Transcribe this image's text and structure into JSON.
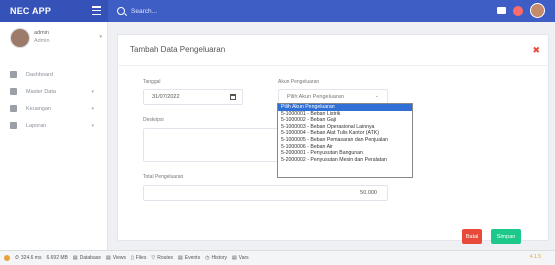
{
  "app": {
    "brand": "NEC APP"
  },
  "header": {
    "search_placeholder": "Search..."
  },
  "user": {
    "name": "admin",
    "role": "Admin"
  },
  "sidebar": {
    "items": [
      {
        "label": "Dashboard",
        "icon": "home-icon"
      },
      {
        "label": "Master Data",
        "icon": "database-icon"
      },
      {
        "label": "Keuangan",
        "icon": "money-icon"
      },
      {
        "label": "Laporan",
        "icon": "file-icon"
      }
    ]
  },
  "form": {
    "title": "Tambah Data Pengeluaran",
    "date_label": "Tanggal",
    "date_value": "31/07/2022",
    "account_label": "Akun Pengeluaran",
    "account_selected": "Pilih Akun Pengeluaran",
    "description_label": "Deskripsi",
    "total_label": "Total Pengeluaran",
    "total_value": "50.000",
    "cancel_label": "Batal",
    "save_label": "Simpan"
  },
  "dropdown": {
    "options": [
      "Pilih Akun Pengeluaran",
      "5-1000001 - Beban Listrik",
      "5-1000002 - Beban Gaji",
      "5-1000003 - Beban Operasional Lainnya",
      "5-1000004 - Beban Alat Tulis Kantor (ATK)",
      "5-1000005 - Beban Pemasaran dan Penjualan",
      "5-1000006 - Beban Air",
      "5-2000001 - Penyusutan Bangunan",
      "5-2000002 - Penyusutan Mesin dan Peralatan"
    ]
  },
  "debugbar": {
    "time": "324.6 ms",
    "memory": "6.692 MB",
    "items": [
      {
        "label": "Database",
        "count": ""
      },
      {
        "label": "Views",
        "count": ""
      },
      {
        "label": "Files",
        "count": ""
      },
      {
        "label": "Routes",
        "count": ""
      },
      {
        "label": "Events",
        "count": ""
      },
      {
        "label": "History",
        "count": ""
      },
      {
        "label": "Vars",
        "count": ""
      }
    ],
    "version": "4.1.5"
  },
  "colors": {
    "primary": "#3f5ec5",
    "danger": "#e74a3b",
    "success": "#1cc88a"
  }
}
